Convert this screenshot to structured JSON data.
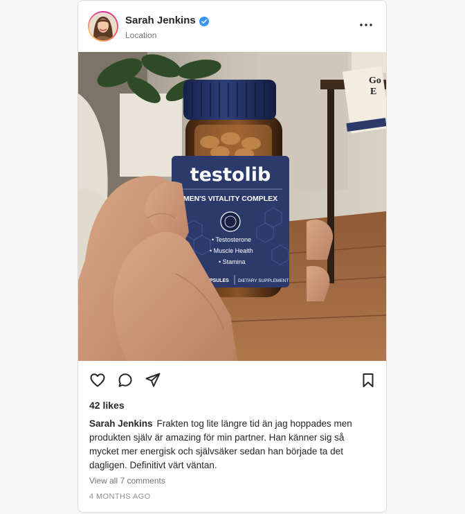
{
  "post": {
    "username": "Sarah Jenkins",
    "location": "Location",
    "verified_icon": "verified-badge-icon",
    "more_icon": "more-options-icon",
    "image": {
      "brand": "testolib",
      "product_line": "MEN'S VITALITY COMPLEX",
      "bullets": [
        "• Testosterone",
        "• Muscle Health",
        "• Stamina"
      ],
      "capsules": "30 CAPSULES",
      "supplement": "DIETARY SUPPLEMENT",
      "book_text": "Go E"
    },
    "actions": [
      "heart-icon",
      "comment-icon",
      "share-icon",
      "bookmark-icon"
    ],
    "likes": "42 likes",
    "caption_user": "Sarah Jenkins",
    "caption_text": "Frakten tog lite längre tid än jag hoppades men produkten själv är amazing för min partner. Han känner sig så mycket mer energisk och självsäker sedan han började ta det dagligen. Definitivt värt väntan.",
    "view_comments": "View all 7 comments",
    "time_ago": "4 MONTHS AGO"
  },
  "colors": {
    "verified": "#3897f0",
    "bottle_label": "#2b3a6b",
    "cap": "#1f2d5c",
    "background": "#f6f6f7"
  }
}
